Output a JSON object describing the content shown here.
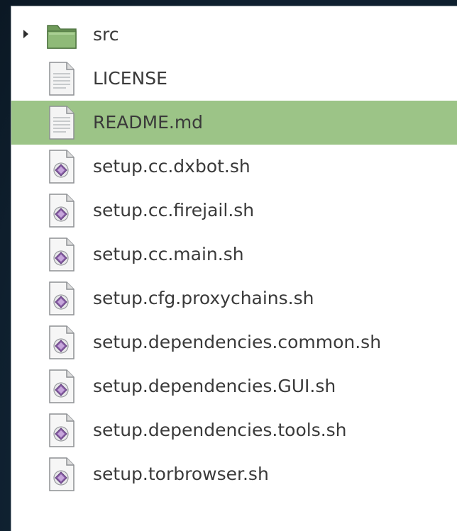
{
  "files": [
    {
      "name": "src",
      "type": "folder",
      "icon": "folder-icon",
      "expandable": true
    },
    {
      "name": "LICENSE",
      "type": "text",
      "icon": "text-file-icon"
    },
    {
      "name": "README.md",
      "type": "text",
      "icon": "text-file-icon",
      "selected": true
    },
    {
      "name": "setup.cc.dxbot.sh",
      "type": "script",
      "icon": "script-file-icon"
    },
    {
      "name": "setup.cc.firejail.sh",
      "type": "script",
      "icon": "script-file-icon"
    },
    {
      "name": "setup.cc.main.sh",
      "type": "script",
      "icon": "script-file-icon"
    },
    {
      "name": "setup.cfg.proxychains.sh",
      "type": "script",
      "icon": "script-file-icon"
    },
    {
      "name": "setup.dependencies.common.sh",
      "type": "script",
      "icon": "script-file-icon"
    },
    {
      "name": "setup.dependencies.GUI.sh",
      "type": "script",
      "icon": "script-file-icon"
    },
    {
      "name": "setup.dependencies.tools.sh",
      "type": "script",
      "icon": "script-file-icon"
    },
    {
      "name": "setup.torbrowser.sh",
      "type": "script",
      "icon": "script-file-icon"
    }
  ],
  "colors": {
    "selection": "#9cc487",
    "folder": "#7fa86a",
    "script_badge": "#8a5fa8",
    "text": "#3a3a3a"
  }
}
